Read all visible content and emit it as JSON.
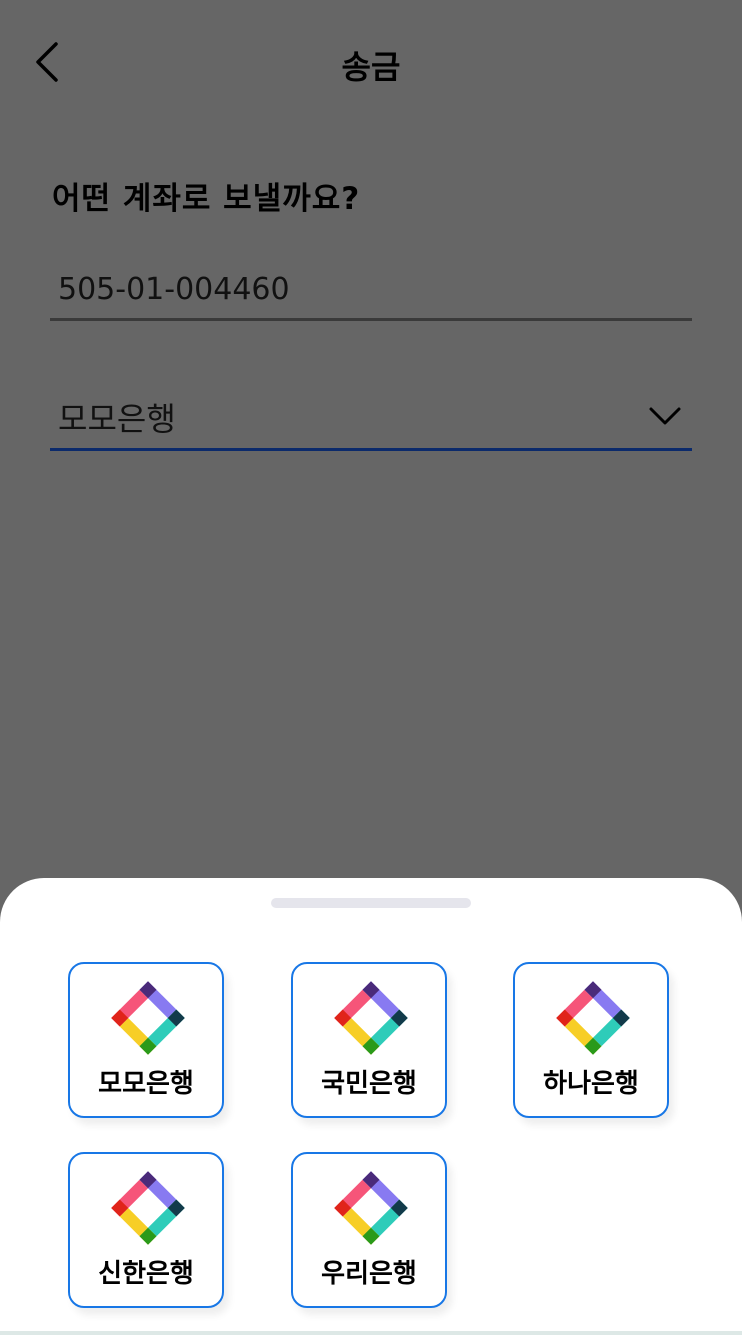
{
  "header": {
    "title": "송금"
  },
  "form": {
    "question": "어떤 계좌로 보낼까요?",
    "account_number": "505-01-004460",
    "selected_bank": "모모은행"
  },
  "bank_sheet": {
    "banks": [
      {
        "name": "모모은행"
      },
      {
        "name": "국민은행"
      },
      {
        "name": "하나은행"
      },
      {
        "name": "신한은행"
      },
      {
        "name": "우리은행"
      }
    ]
  },
  "colors": {
    "overlay": "#666666",
    "card_border": "#1877e6",
    "select_underline": "#0b2a6b",
    "logo_purple": "#7b6cf0",
    "logo_teal": "#17c7b1",
    "logo_red": "#f5426a",
    "logo_yellow": "#f6c90e"
  },
  "icons": {
    "back": "chevron-left-icon",
    "dropdown": "chevron-down-icon",
    "bank_logo": "bank-logo-icon"
  }
}
